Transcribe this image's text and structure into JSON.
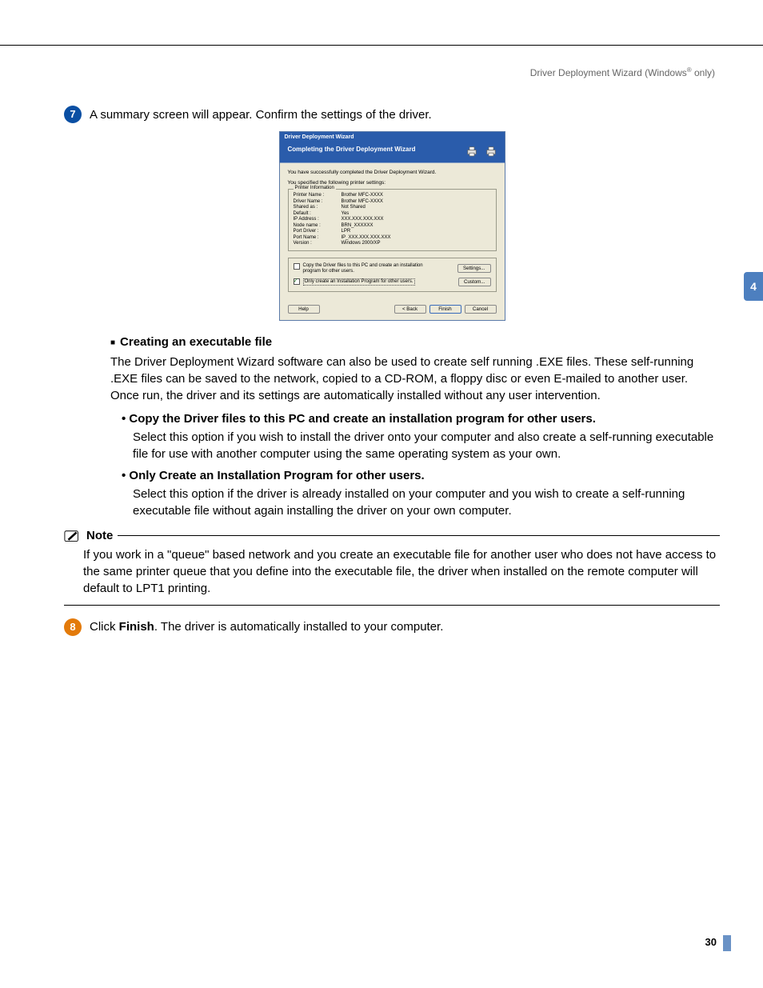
{
  "header": {
    "text_pre": "Driver Deployment Wizard (Windows",
    "text_post": " only)"
  },
  "side_tab": "4",
  "step7": {
    "num": "7",
    "text": "A summary screen will appear. Confirm the settings of the driver."
  },
  "dialog": {
    "title": "Driver Deployment Wizard",
    "banner": "Completing the Driver Deployment Wizard",
    "msg1": "You have successfully completed the Driver Deployment Wizard.",
    "msg2": "You specified the following printer settings:",
    "info_legend": "Printer Information",
    "info": [
      {
        "k": "Printer Name :",
        "v": "Brother MFC-XXXX"
      },
      {
        "k": "Driver Name :",
        "v": "Brother MFC-XXXX"
      },
      {
        "k": "Shared as :",
        "v": "Not Shared"
      },
      {
        "k": "Default :",
        "v": "Yes"
      },
      {
        "k": "IP Address :",
        "v": "XXX.XXX.XXX.XXX"
      },
      {
        "k": "Node name :",
        "v": "BRN_XXXXXX"
      },
      {
        "k": "Port Driver :",
        "v": "LPR"
      },
      {
        "k": "Port Name :",
        "v": "IP_XXX.XXX.XXX.XXX"
      },
      {
        "k": "Version :",
        "v": "Windows 2000/XP"
      }
    ],
    "opt1_label": "Copy the Driver files to this PC and create an installation program for other users.",
    "opt2_label": "Only create an Installation Program for other users.",
    "btn_settings": "Settings...",
    "btn_custom": "Custom...",
    "btn_help": "Help",
    "btn_back": "< Back",
    "btn_finish": "Finish",
    "btn_cancel": "Cancel"
  },
  "exec_heading": "Creating an executable file",
  "exec_para": "The Driver Deployment Wizard software can also be used to create self running .EXE files. These self-running .EXE files can be saved to the network, copied to a CD-ROM, a floppy disc or even E-mailed to another user. Once run, the driver and its settings are automatically installed without any user intervention.",
  "sub1_h": "Copy the Driver files to this PC and create an installation program for other users.",
  "sub1_p": "Select this option if you wish to install the driver onto your computer and also create a self-running executable file for use with another computer using the same operating system as your own.",
  "sub2_h": "Only Create an Installation Program for other users.",
  "sub2_p": "Select this option if the driver is already installed on your computer and you wish to create a self-running executable file without again installing the driver on your own computer.",
  "note_label": "Note",
  "note_body": "If you work in a \"queue\" based network and you create an executable file for another user who does not have access to the same printer queue that you define into the executable file, the driver when installed on the remote computer will default to LPT1 printing.",
  "step8": {
    "num": "8",
    "text_pre": "Click ",
    "text_bold": "Finish",
    "text_post": ". The driver is automatically installed to your computer."
  },
  "page_num": "30"
}
